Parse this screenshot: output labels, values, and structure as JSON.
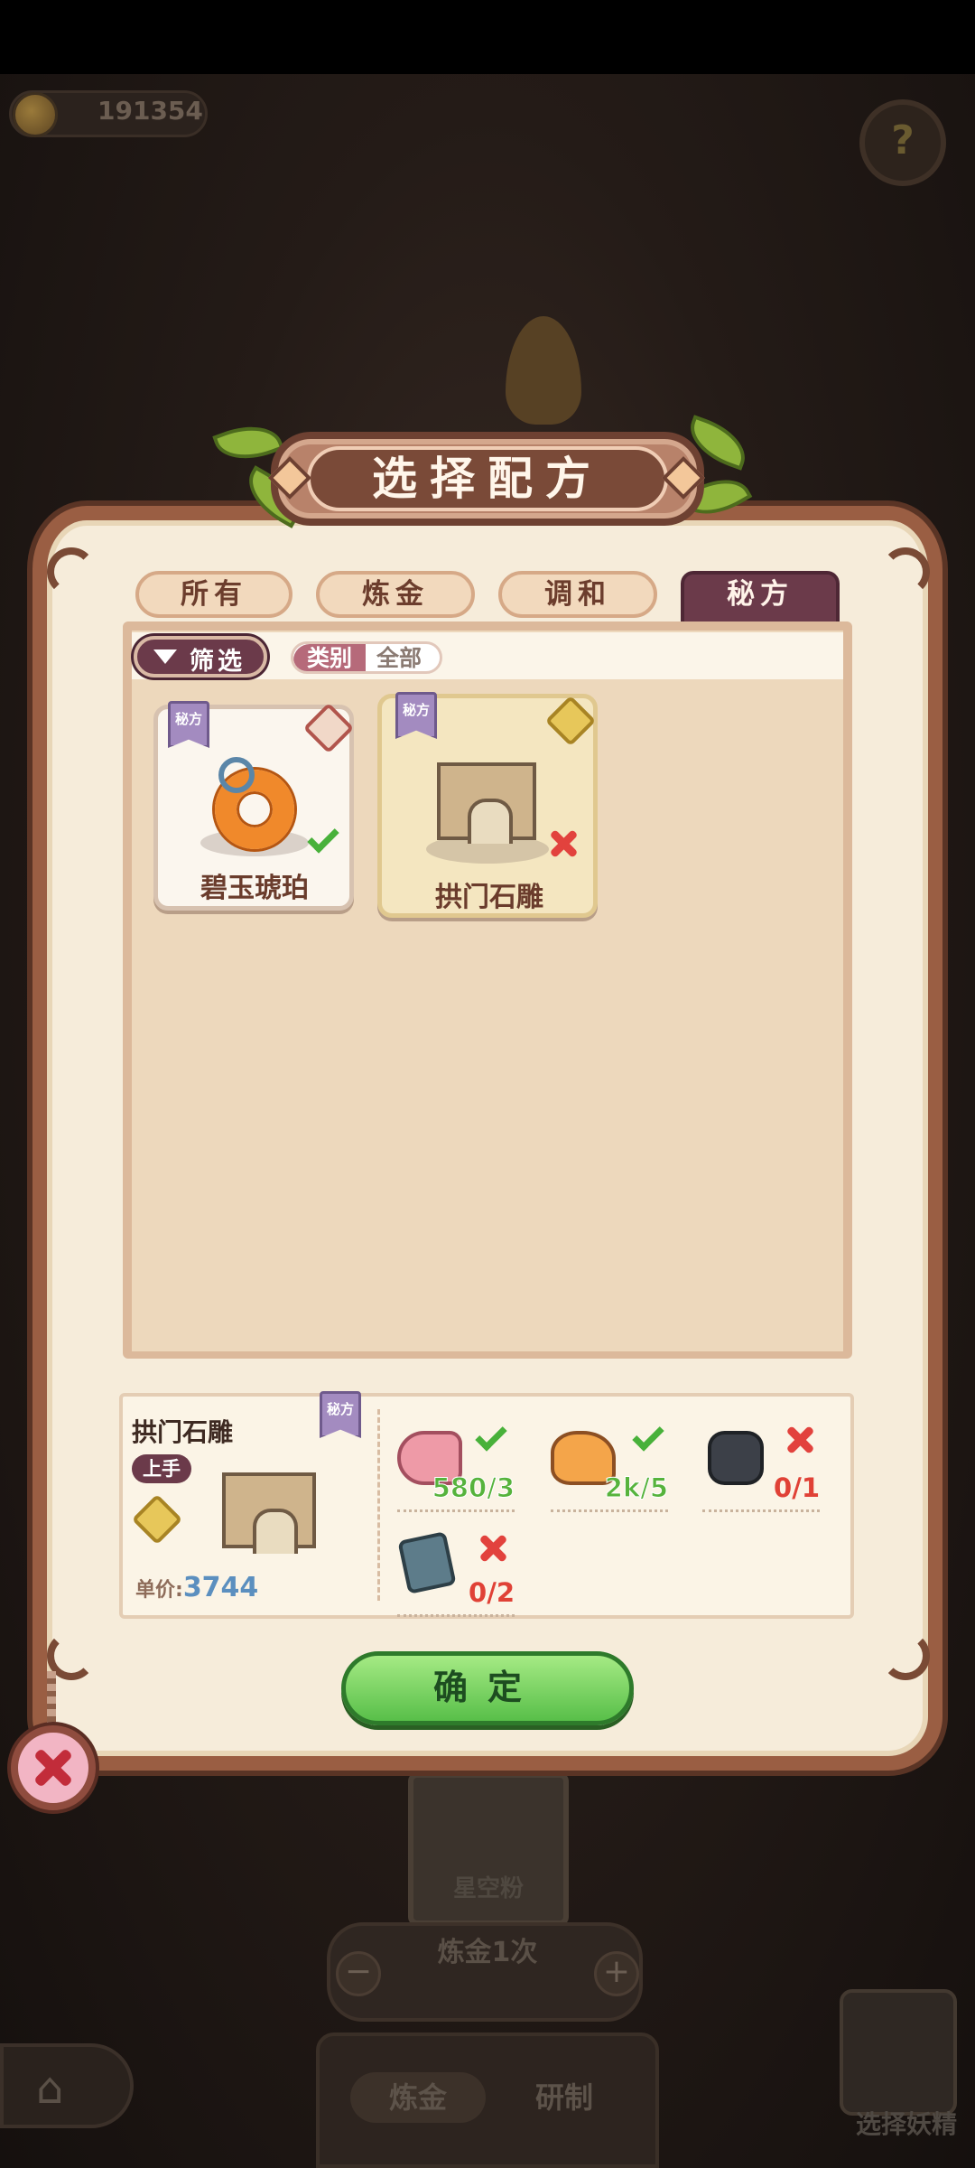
{
  "top": {
    "coin_value": "191354",
    "help_icon": "question-icon"
  },
  "dialog": {
    "title": "选择配方",
    "tabs": [
      {
        "label": "所有",
        "active": false
      },
      {
        "label": "炼金",
        "active": false
      },
      {
        "label": "调和",
        "active": false
      },
      {
        "label": "秘方",
        "active": true
      }
    ],
    "filter": {
      "button_label": "筛选",
      "category_key": "类别",
      "category_value": "全部"
    },
    "recipes": [
      {
        "name": "碧玉琥珀",
        "tag": "秘方",
        "craftable": true,
        "icon": "amber-ring-icon"
      },
      {
        "name": "拱门石雕",
        "tag": "秘方",
        "craftable": false,
        "icon": "stone-arch-icon"
      }
    ],
    "detail": {
      "name": "拱门石雕",
      "tag": "秘方",
      "skill": "上手",
      "price_label": "单价:",
      "price_value": "3744",
      "materials": [
        {
          "icon": "pink-meat-icon",
          "count": "580/3",
          "ok": true
        },
        {
          "icon": "orange-ore-icon",
          "count": "2k/5",
          "ok": true
        },
        {
          "icon": "dark-stone-icon",
          "count": "0/1",
          "ok": false
        },
        {
          "icon": "rune-tablet-icon",
          "count": "0/2",
          "ok": false
        }
      ]
    },
    "confirm_label": "确定"
  },
  "background": {
    "card_label": "星空粉",
    "craft_count": "炼金1次",
    "bottom_tabs": [
      "炼金",
      "研制"
    ],
    "select_fairy": "选择妖精"
  },
  "colors": {
    "accent_panel": "#9a5e43",
    "active_tab": "#6b3a4a",
    "confirm_green": "#58bf49"
  }
}
